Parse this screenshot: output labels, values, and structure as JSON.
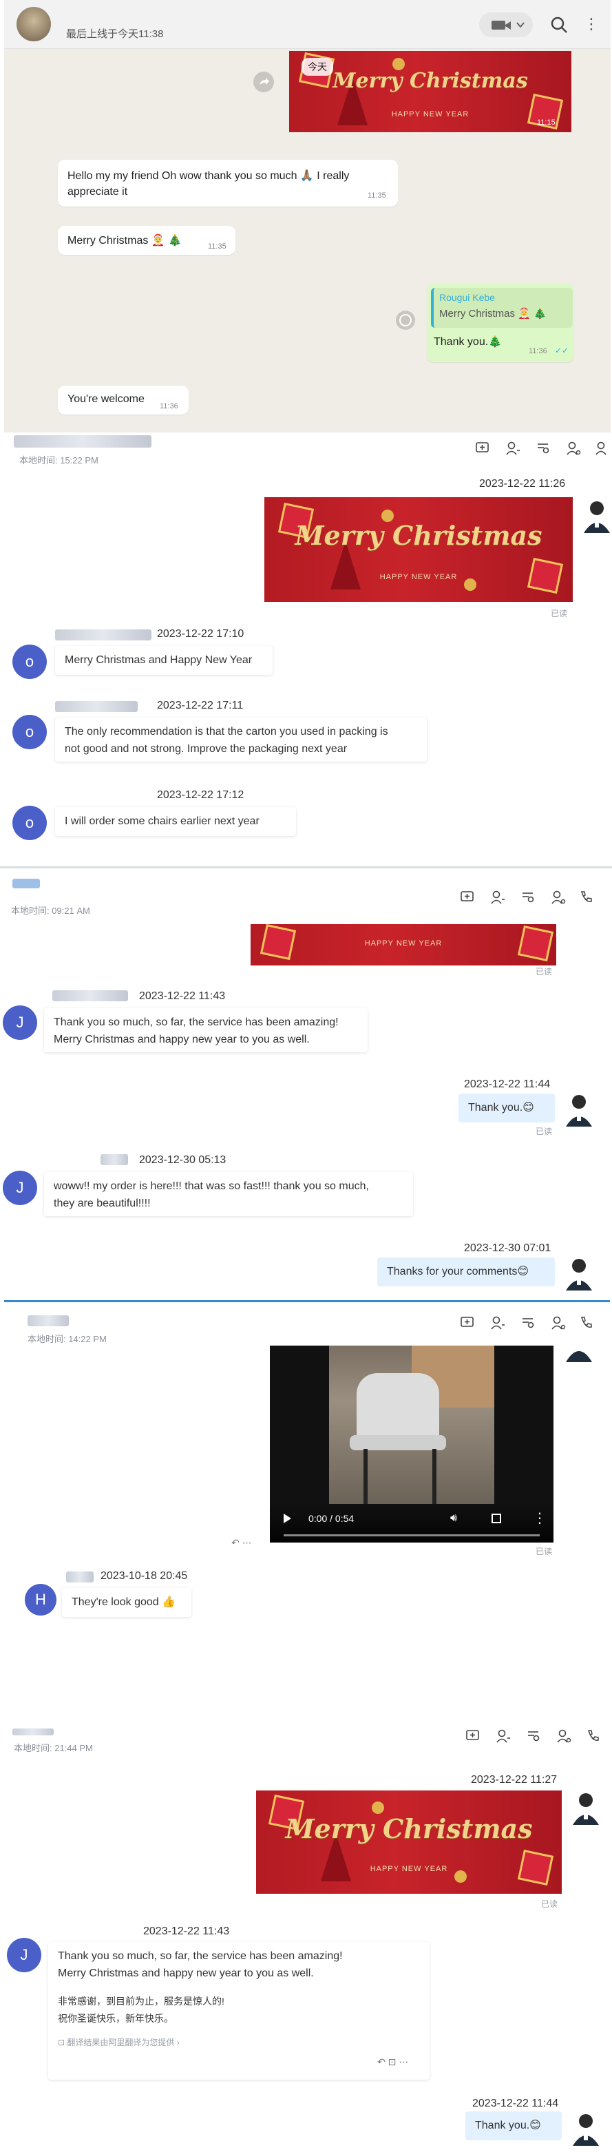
{
  "whatsapp": {
    "status": "最后上线于今天11:38",
    "date_chip": "今天",
    "card_title": "Merry Christmas",
    "card_subtitle": "HAPPY NEW YEAR",
    "card_time": "11:15",
    "messages": [
      {
        "text": "Hello my my friend Oh wow thank you so much 🙏🏽 I really appreciate it",
        "time": "11:35"
      },
      {
        "text": "Merry Christmas 🤶 🎄",
        "time": "11:35"
      },
      {
        "quote_author": "Rougui Kebe",
        "quote_text": "Merry Christmas 🤶 🎄",
        "text": "Thank you.🎄",
        "time": "11:36"
      },
      {
        "text": "You're welcome",
        "time": "11:36"
      }
    ]
  },
  "section1": {
    "local_time": "本地时间: 15:22 PM",
    "agent_time": "2023-12-22 11:26",
    "read": "已读",
    "card_title": "Merry Christmas",
    "card_subtitle": "HAPPY NEW YEAR",
    "avatar_letter": "o",
    "messages": [
      {
        "time": "2023-12-22 17:10",
        "text": "Merry Christmas and Happy New Year"
      },
      {
        "time": "2023-12-22 17:11",
        "text1": "The only recommendation is that the carton you used in packing is",
        "text2": "not good and not strong. Improve the packaging next year"
      },
      {
        "time": "2023-12-22 17:12",
        "text": "I will order some chairs earlier next year"
      }
    ]
  },
  "section2": {
    "local_time": "本地时间: 09:21 AM",
    "card_subtitle": "HAPPY NEW YEAR",
    "read": "已读",
    "avatar_letter": "J",
    "messages": [
      {
        "time": "2023-12-22 11:43",
        "text1": "Thank you so much, so far, the service has been amazing!",
        "text2": "Merry Christmas and happy new year to you as well."
      },
      {
        "time": "2023-12-22 11:44",
        "text": "Thank you.😊",
        "me": true
      },
      {
        "time": "2023-12-30 05:13",
        "text1": "woww!! my order is here!!! that was so fast!!! thank you so much,",
        "text2": "they are beautiful!!!!"
      },
      {
        "time": "2023-12-30 07:01",
        "text": "Thanks for your comments😊",
        "me": true
      }
    ]
  },
  "section3": {
    "local_time": "本地时间: 14:22 PM",
    "video_time": "0:00 / 0:54",
    "read": "已读",
    "avatar_letter": "H",
    "message_time": "2023-10-18 20:45",
    "message_text": "They're look good 👍"
  },
  "section4": {
    "local_time": "本地时间: 21:44 PM",
    "agent_time": "2023-12-22 11:27",
    "read": "已读",
    "card_title": "Merry Christmas",
    "card_subtitle": "HAPPY NEW YEAR",
    "avatar_letter": "J",
    "message_time": "2023-12-22 11:43",
    "message_text1": "Thank you so much, so far, the service has been amazing!",
    "message_text2": "Merry Christmas and happy new year to you as well.",
    "translation1": "非常感谢，到目前为止，服务是惊人的!",
    "translation2": "祝你圣诞快乐，新年快乐。",
    "translation_note": "翻译结果由阿里翻译为您提供",
    "reply_time": "2023-12-22 11:44",
    "reply_text": "Thank you.😊"
  },
  "colors": {
    "avatar": "#4a5fc8",
    "agent_bubble": "#e3f1ff",
    "whatsapp_bg": "#f0ece6",
    "card_red": "#c8232b",
    "gold": "#f0d48a"
  }
}
